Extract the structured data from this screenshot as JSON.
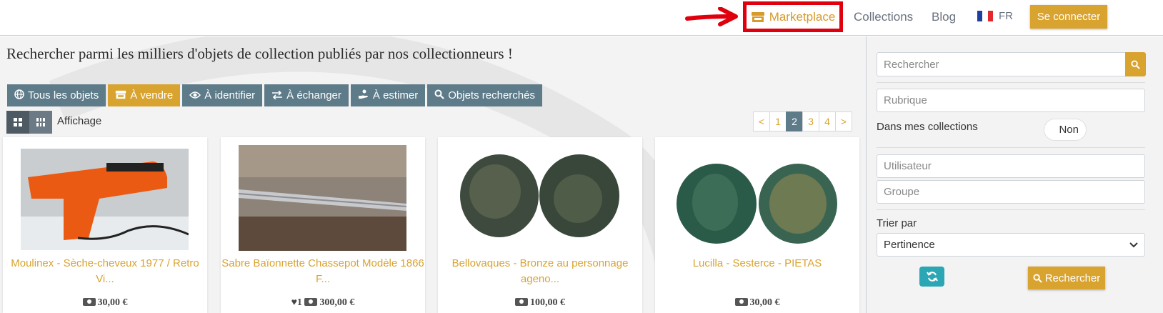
{
  "colors": {
    "accent": "#d9a32f",
    "tab": "#5e7b89",
    "highlight": "#e0000d",
    "teal": "#2aa6b5"
  },
  "nav": {
    "marketplace": "Marketplace",
    "collections": "Collections",
    "blog": "Blog",
    "lang": "FR",
    "connect": "Se connecter"
  },
  "main": {
    "headline": "Rechercher parmi les milliers d'objets de collection publiés par nos collectionneurs !",
    "tabs": [
      {
        "label": "Tous les objets",
        "icon": "globe-icon",
        "active": false
      },
      {
        "label": "À vendre",
        "icon": "store-icon",
        "active": true
      },
      {
        "label": "À identifier",
        "icon": "eye-icon",
        "active": false
      },
      {
        "label": "À échanger",
        "icon": "exchange-icon",
        "active": false
      },
      {
        "label": "À estimer",
        "icon": "hand-coins-icon",
        "active": false
      },
      {
        "label": "Objets recherchés",
        "icon": "search-icon",
        "active": false
      }
    ],
    "display_label": "Affichage",
    "pagination": {
      "prev": "<",
      "pages": [
        "1",
        "2",
        "3",
        "4"
      ],
      "current": "2",
      "next": ">"
    },
    "cards": [
      {
        "title_line1": "Moulinex - Sèche-cheveux 1977 / Retro",
        "title_line2": "Vi...",
        "likes": "",
        "price": "30,00 €"
      },
      {
        "title_line1": "Sabre Baïonnette Chassepot Modèle 1866",
        "title_line2": "F...",
        "likes": "1",
        "price": "300,00 €"
      },
      {
        "title_line1": "Bellovaques - Bronze au personnage",
        "title_line2": "ageno...",
        "likes": "",
        "price": "100,00 €"
      },
      {
        "title_line1": "",
        "title_line2": "Lucilla - Sesterce - PIETAS",
        "likes": "",
        "price": "30,00 €"
      }
    ]
  },
  "sidebar": {
    "search_placeholder": "Rechercher",
    "rubrique_placeholder": "Rubrique",
    "in_my_collections": "Dans mes collections",
    "toggle_value": "Non",
    "user_placeholder": "Utilisateur",
    "group_placeholder": "Groupe",
    "sort_label": "Trier par",
    "sort_value": "Pertinence",
    "submit": "Rechercher"
  }
}
